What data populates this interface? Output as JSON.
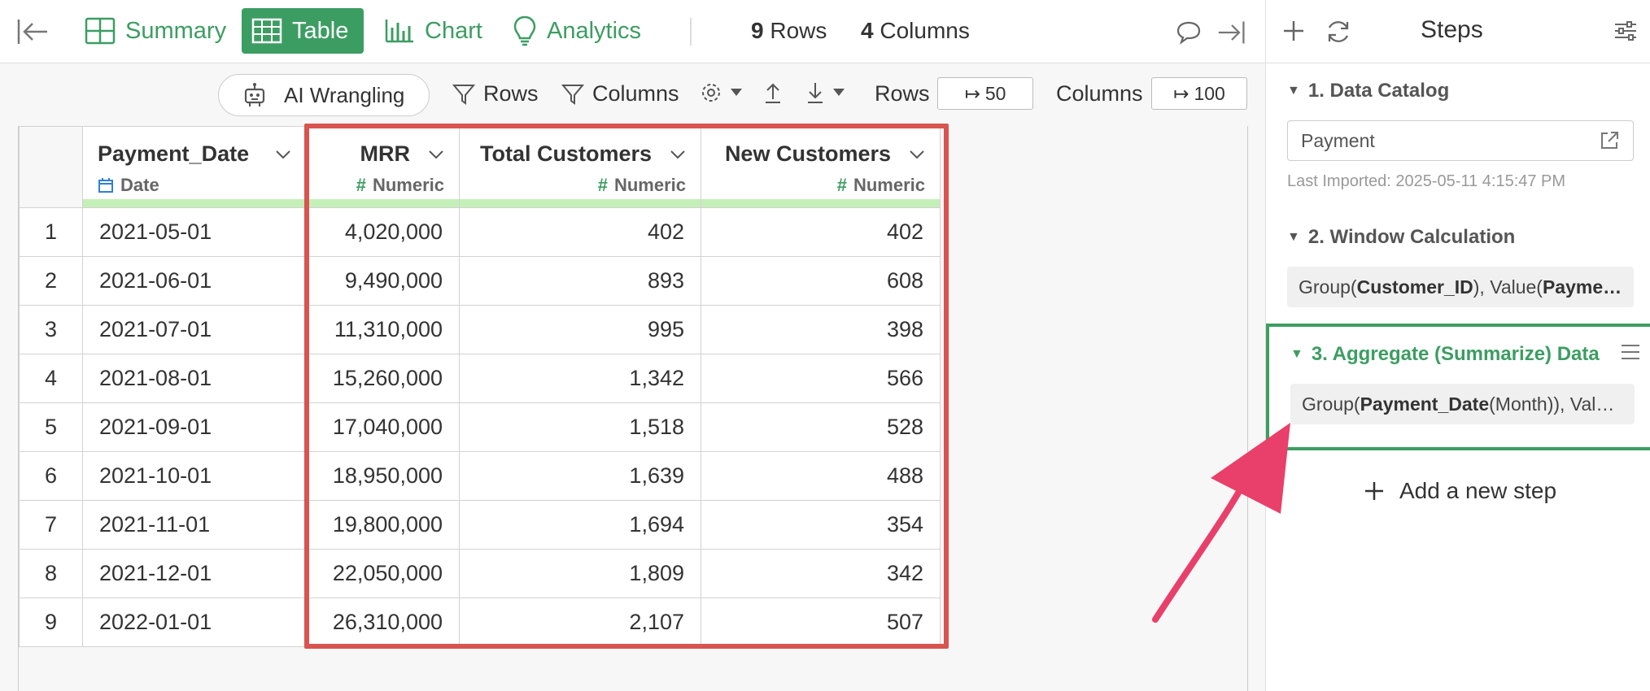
{
  "topbar": {
    "tabs": [
      {
        "label": "Summary",
        "icon": "summary-icon"
      },
      {
        "label": "Table",
        "icon": "table-icon",
        "active": true
      },
      {
        "label": "Chart",
        "icon": "chart-icon"
      },
      {
        "label": "Analytics",
        "icon": "lightbulb-icon"
      }
    ],
    "rows_count": "9",
    "rows_label": "Rows",
    "cols_count": "4",
    "cols_label": "Columns"
  },
  "toolbar": {
    "ai_label": "AI Wrangling",
    "rows_filter": "Rows",
    "columns_filter": "Columns",
    "rows_label": "Rows",
    "rows_value": "50",
    "columns_label": "Columns",
    "columns_value": "100"
  },
  "table": {
    "columns": [
      {
        "name": "Payment_Date",
        "type": "Date"
      },
      {
        "name": "MRR",
        "type": "Numeric"
      },
      {
        "name": "Total Customers",
        "type": "Numeric"
      },
      {
        "name": "New Customers",
        "type": "Numeric"
      }
    ],
    "rows": [
      {
        "n": "1",
        "date": "2021-05-01",
        "mrr": "4,020,000",
        "total": "402",
        "new": "402"
      },
      {
        "n": "2",
        "date": "2021-06-01",
        "mrr": "9,490,000",
        "total": "893",
        "new": "608"
      },
      {
        "n": "3",
        "date": "2021-07-01",
        "mrr": "11,310,000",
        "total": "995",
        "new": "398"
      },
      {
        "n": "4",
        "date": "2021-08-01",
        "mrr": "15,260,000",
        "total": "1,342",
        "new": "566"
      },
      {
        "n": "5",
        "date": "2021-09-01",
        "mrr": "17,040,000",
        "total": "1,518",
        "new": "528"
      },
      {
        "n": "6",
        "date": "2021-10-01",
        "mrr": "18,950,000",
        "total": "1,639",
        "new": "488"
      },
      {
        "n": "7",
        "date": "2021-11-01",
        "mrr": "19,800,000",
        "total": "1,694",
        "new": "354"
      },
      {
        "n": "8",
        "date": "2021-12-01",
        "mrr": "22,050,000",
        "total": "1,809",
        "new": "342"
      },
      {
        "n": "9",
        "date": "2022-01-01",
        "mrr": "26,310,000",
        "total": "2,107",
        "new": "507"
      }
    ]
  },
  "panel": {
    "title": "Steps",
    "steps": [
      {
        "title": "1. Data Catalog",
        "value": "Payment",
        "note": "Last Imported: 2025-05-11 4:15:47 PM"
      },
      {
        "title": "2. Window Calculation",
        "p1": "Group(",
        "b1": "Customer_ID",
        "p2": "), Value(",
        "b2": "Payme…"
      },
      {
        "title": "3. Aggregate (Summarize) Data",
        "p1": "Group(",
        "b1": "Payment_Date",
        "p2": " (Month)), Val…"
      }
    ],
    "add_step": "Add a new step"
  },
  "colors": {
    "accent": "#3c9d62",
    "highlight": "#d9534f",
    "arrow": "#e8406a"
  }
}
